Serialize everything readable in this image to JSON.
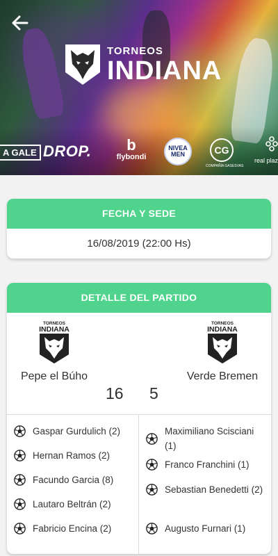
{
  "header": {
    "back_icon": "arrow-left-icon",
    "logo_top": "TORNEOS",
    "logo_main": "INDIANA",
    "sponsors": {
      "gale": "A GALE",
      "drop": "DROP.",
      "flybondi_mark": "b",
      "flybondi": "flybondi",
      "nivea_top": "NIVEA",
      "nivea_bottom": "MEN",
      "cg": "CG",
      "cg_sub": "COMPAÑÍA GASESVAS",
      "real_plaza": "real plaza"
    }
  },
  "fecha": {
    "title": "FECHA Y SEDE",
    "value": "16/08/2019 (22:00 Hs)"
  },
  "detalle": {
    "title": "DETALLE DEL PARTIDO",
    "home": {
      "name": "Pepe el Búho",
      "score": "16"
    },
    "away": {
      "name": "Verde Bremen",
      "score": "5"
    },
    "home_scorers": [
      "Gaspar Gurdulich (2)",
      "Hernan Ramos (2)",
      "Facundo Garcia (8)",
      "Lautaro Beltrán (2)",
      "Fabricio Encina (2)"
    ],
    "away_scorers": [
      "Maximiliano Scisciani (1)",
      "Franco Franchini (1)",
      "Sebastian Benedetti (2)",
      "Augusto Furnari (1)"
    ]
  },
  "colors": {
    "accent_green": "#4fd38d",
    "background": "#f2f2f2"
  }
}
